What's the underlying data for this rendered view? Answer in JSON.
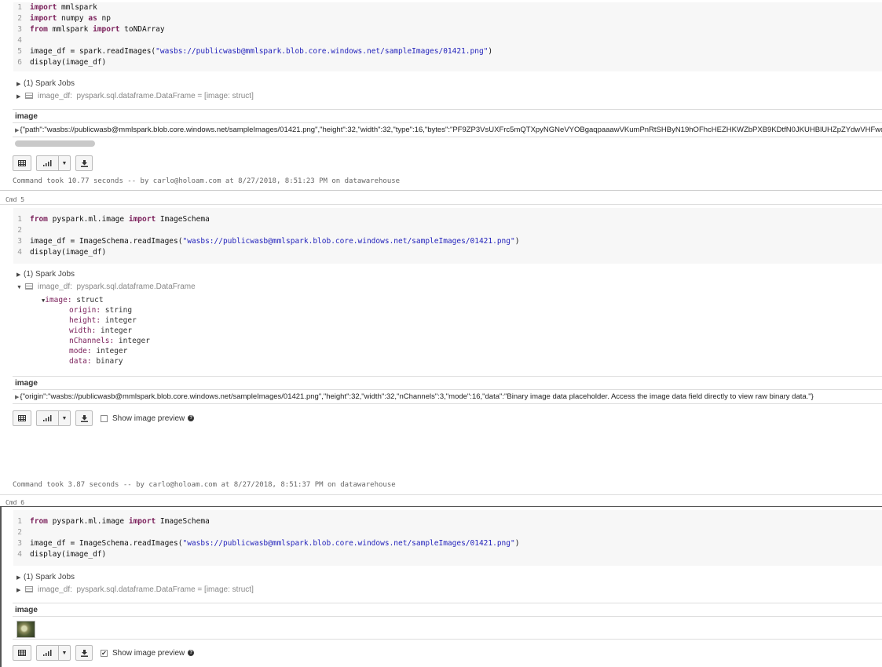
{
  "cmd_labels": {
    "cmd5": "Cmd 5",
    "cmd6": "Cmd 6"
  },
  "cell1": {
    "code": [
      {
        "num": "1",
        "seg": [
          {
            "t": "import",
            "c": "kw"
          },
          {
            "t": " mmlspark"
          }
        ]
      },
      {
        "num": "2",
        "seg": [
          {
            "t": "import",
            "c": "kw"
          },
          {
            "t": " numpy "
          },
          {
            "t": "as",
            "c": "kw"
          },
          {
            "t": " np"
          }
        ]
      },
      {
        "num": "3",
        "seg": [
          {
            "t": "from",
            "c": "kw"
          },
          {
            "t": " mmlspark "
          },
          {
            "t": "import",
            "c": "kw"
          },
          {
            "t": " toNDArray"
          }
        ]
      },
      {
        "num": "4",
        "seg": []
      },
      {
        "num": "5",
        "seg": [
          {
            "t": "image_df = spark.readImages("
          },
          {
            "t": "\"wasbs://publicwasb@mmlspark.blob.core.windows.net/sampleImages/01421.png\"",
            "c": "str"
          },
          {
            "t": ")"
          }
        ]
      },
      {
        "num": "6",
        "seg": [
          {
            "t": "display(image_df)"
          }
        ]
      }
    ],
    "spark_jobs": "(1) Spark Jobs",
    "df_name": "image_df:",
    "df_type": "pyspark.sql.dataframe.DataFrame = [image: struct]",
    "col_header": "image",
    "row_value": "{\"path\":\"wasbs://publicwasb@mmlspark.blob.core.windows.net/sampleImages/01421.png\",\"height\":32,\"width\":32,\"type\":16,\"bytes\":\"PF9ZP3VsUXFrc5mQTXpyNGNeVYOBgaqpaaawVKumPnRtSHByN19hOFhcHEZHKWZbPXB9KDtfN0JKUHBlUHZpZYdwVHFwdVd",
    "footer": "Command took 10.77 seconds -- by carlo@holoam.com at 8/27/2018, 8:51:23 PM on datawarehouse"
  },
  "cell2": {
    "code": [
      {
        "num": "1",
        "seg": [
          {
            "t": "from",
            "c": "kw"
          },
          {
            "t": " pyspark.ml.image "
          },
          {
            "t": "import",
            "c": "kw"
          },
          {
            "t": " ImageSchema"
          }
        ]
      },
      {
        "num": "2",
        "seg": []
      },
      {
        "num": "3",
        "seg": [
          {
            "t": "image_df = ImageSchema.readImages("
          },
          {
            "t": "\"wasbs://publicwasb@mmlspark.blob.core.windows.net/sampleImages/01421.png\"",
            "c": "str"
          },
          {
            "t": ")"
          }
        ]
      },
      {
        "num": "4",
        "seg": [
          {
            "t": "display(image_df)"
          }
        ]
      }
    ],
    "spark_jobs": "(1) Spark Jobs",
    "df_name": "image_df:",
    "df_type": "pyspark.sql.dataframe.DataFrame",
    "schema": [
      {
        "k": "image:",
        "v": " struct"
      },
      {
        "k": "origin:",
        "v": " string"
      },
      {
        "k": "height:",
        "v": " integer"
      },
      {
        "k": "width:",
        "v": " integer"
      },
      {
        "k": "nChannels:",
        "v": " integer"
      },
      {
        "k": "mode:",
        "v": " integer"
      },
      {
        "k": "data:",
        "v": " binary"
      }
    ],
    "col_header": "image",
    "row_value": "{\"origin\":\"wasbs://publicwasb@mmlspark.blob.core.windows.net/sampleImages/01421.png\",\"height\":32,\"width\":32,\"nChannels\":3,\"mode\":16,\"data\":\"Binary image data placeholder. Access the image data field directly to view raw binary data.\"}",
    "show_preview": "Show image preview",
    "footer": "Command took 3.87 seconds -- by carlo@holoam.com at 8/27/2018, 8:51:37 PM on datawarehouse"
  },
  "cell3": {
    "code": [
      {
        "num": "1",
        "seg": [
          {
            "t": "from",
            "c": "kw"
          },
          {
            "t": " pyspark.ml.image "
          },
          {
            "t": "import",
            "c": "kw"
          },
          {
            "t": " ImageSchema"
          }
        ]
      },
      {
        "num": "2",
        "seg": []
      },
      {
        "num": "3",
        "seg": [
          {
            "t": "image_df = ImageSchema.readImages("
          },
          {
            "t": "\"wasbs://publicwasb@mmlspark.blob.core.windows.net/sampleImages/01421.png\"",
            "c": "str"
          },
          {
            "t": ")"
          }
        ]
      },
      {
        "num": "4",
        "seg": [
          {
            "t": "display(image_df)"
          }
        ]
      }
    ],
    "spark_jobs": "(1) Spark Jobs",
    "df_name": "image_df:",
    "df_type": "pyspark.sql.dataframe.DataFrame = [image: struct]",
    "col_header": "image",
    "show_preview": "Show image preview",
    "preview_checked_mark": "✔"
  },
  "icons": {
    "table": "table-icon",
    "chart": "bar-chart-icon",
    "caret": "caret-down-icon",
    "download": "download-icon",
    "help": "question-circle-icon"
  }
}
